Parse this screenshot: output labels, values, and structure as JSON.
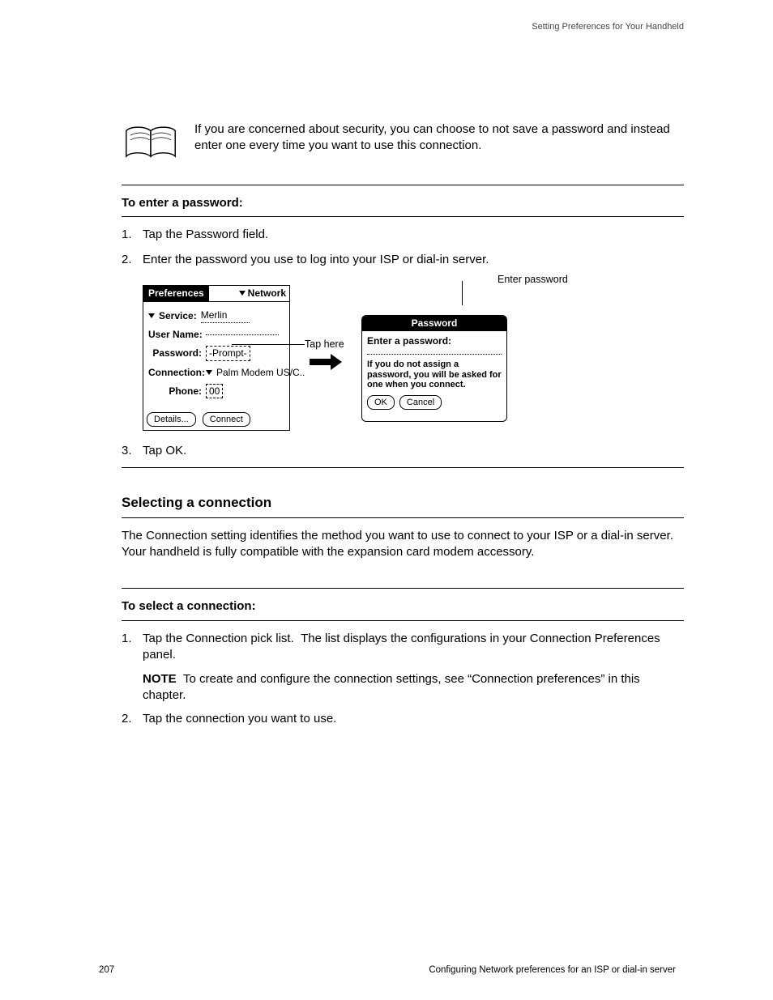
{
  "running_head": "Setting Preferences for Your Handheld",
  "tip": "If you are concerned about security, you can choose to not save a password and instead enter one every time you want to use this connection.",
  "sections": {
    "enter_password": {
      "heading_prefix": "To enter a password: ",
      "steps": [
        "Tap the Password field.",
        "Enter the password you use to log into your ISP or dial-in server.",
        "Tap OK."
      ],
      "callouts": {
        "tap_here": "Tap here",
        "enter_password": "Enter password"
      }
    },
    "selecting_connection": {
      "h2": "Selecting a connection",
      "body": "The Connection setting identifies the method you want to use to connect to your ISP or a dial-in server. Your handheld is fully compatible with the expansion card modem accessory."
    },
    "select_connection": {
      "heading_prefix": "To select a connection: ",
      "step1_a": "Tap the Connection pick list.  The list displays the configurations in your Connection Preferences panel.",
      "note_label": "NOTE",
      "note_body": "To create and configure the connection settings, see “Connection preferences” in this chapter.",
      "step2": "Tap the connection you want to use."
    }
  },
  "prefs_panel": {
    "title_left": "Preferences",
    "title_right": "Network",
    "fields": {
      "service_label": "Service:",
      "service_value": "Merlin",
      "username_label": "User Name:",
      "username_value": "",
      "password_label": "Password:",
      "password_value": "-Prompt-",
      "connection_label": "Connection:",
      "connection_value": "Palm Modem US/C..",
      "phone_label": "Phone:",
      "phone_value": "00"
    },
    "buttons": {
      "details": "Details...",
      "connect": "Connect"
    }
  },
  "password_dialog": {
    "title": "Password",
    "prompt": "Enter a password:",
    "hint": "If you do not assign a password, you will be asked for one when you connect.",
    "buttons": {
      "ok": "OK",
      "cancel": "Cancel"
    }
  },
  "footer": {
    "page": "207",
    "right": "Configuring Network preferences for an ISP or dial-in server"
  }
}
